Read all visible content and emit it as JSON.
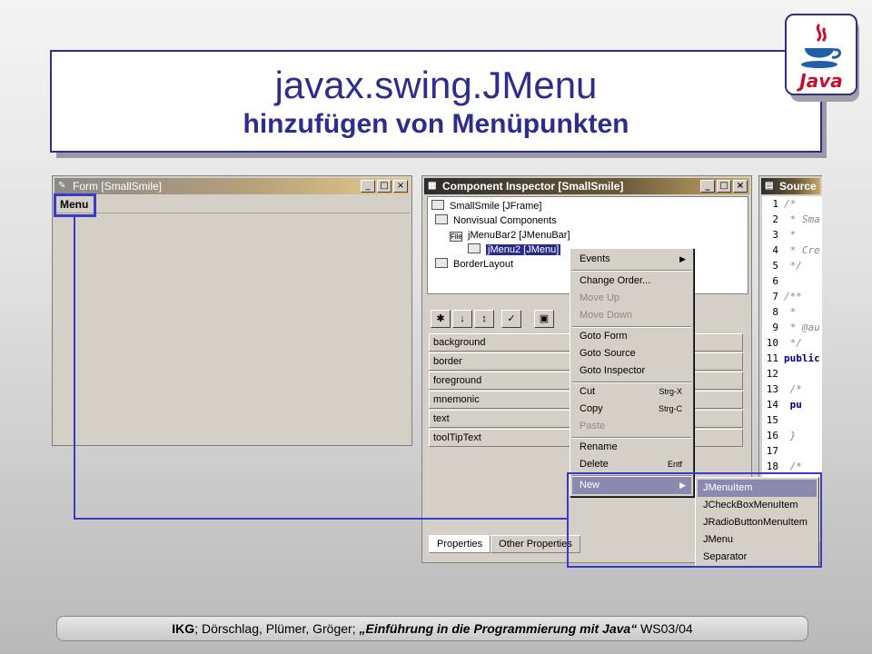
{
  "slide": {
    "title_line1": "javax.swing.JMenu",
    "title_line2": "hinzufügen von Menüpunkten",
    "logo_text": "Java"
  },
  "form_window": {
    "title": "Form [SmallSmile]",
    "menu_label": "Menu"
  },
  "inspector_window": {
    "title": "Component Inspector [SmallSmile]",
    "tree": [
      {
        "label": "SmallSmile [JFrame]"
      },
      {
        "label": "Nonvisual Components"
      },
      {
        "label": "jMenuBar2 [JMenuBar]"
      },
      {
        "label": "jMenu2 [JMenu]"
      },
      {
        "label": "BorderLayout"
      }
    ],
    "properties": [
      "background",
      "border",
      "foreground",
      "mnemonic",
      "text",
      "toolTipText"
    ],
    "tabs": [
      "Properties",
      "Other Properties"
    ]
  },
  "source_window": {
    "title": "Source",
    "lines": [
      {
        "n": "1",
        "t": "/*"
      },
      {
        "n": "2",
        "t": " * Sma"
      },
      {
        "n": "3",
        "t": " *"
      },
      {
        "n": "4",
        "t": " * Cre"
      },
      {
        "n": "5",
        "t": " */"
      },
      {
        "n": "6",
        "t": ""
      },
      {
        "n": "7",
        "t": "/**"
      },
      {
        "n": "8",
        "t": " *"
      },
      {
        "n": "9",
        "t": " * @au"
      },
      {
        "n": "10",
        "t": " */"
      },
      {
        "n": "11",
        "t": "public"
      },
      {
        "n": "12",
        "t": ""
      },
      {
        "n": "13",
        "t": "    /*"
      },
      {
        "n": "14",
        "t": "    pu"
      },
      {
        "n": "15",
        "t": ""
      },
      {
        "n": "16",
        "t": "    }"
      },
      {
        "n": "17",
        "t": ""
      },
      {
        "n": "18",
        "t": "    /*"
      }
    ]
  },
  "context_menu": {
    "events": "Events",
    "change_order": "Change Order...",
    "move_up": "Move Up",
    "move_down": "Move Down",
    "goto_form": "Goto Form",
    "goto_source": "Goto Source",
    "goto_inspector": "Goto Inspector",
    "cut": "Cut",
    "cut_accel": "Strg-X",
    "copy": "Copy",
    "copy_accel": "Strg-C",
    "paste": "Paste",
    "rename": "Rename",
    "delete": "Delete",
    "delete_accel": "Entf",
    "new": "New"
  },
  "submenu": [
    "JMenuItem",
    "JCheckBoxMenuItem",
    "JRadioButtonMenuItem",
    "JMenu",
    "Separator"
  ],
  "footer": {
    "org": "IKG",
    "authors": "; Dörschlag, Plümer, Gröger; ",
    "course": "„Einführung in die Programmierung mit Java“",
    "term": " WS03/04"
  },
  "colors": {
    "accent": "#2d2d8c",
    "highlight_border": "#3a3ac8",
    "menu_highlight": "#8a8ab0"
  }
}
